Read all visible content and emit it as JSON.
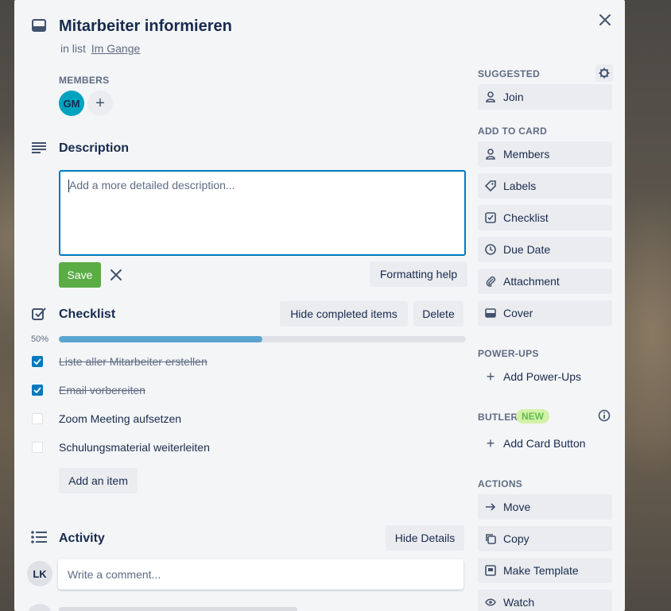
{
  "card": {
    "title": "Mitarbeiter informieren",
    "in_list_prefix": "in list",
    "list_name": "Im Gange"
  },
  "members": {
    "heading": "MEMBERS",
    "avatar_initials": "GM",
    "add_label": "+"
  },
  "description": {
    "title": "Description",
    "placeholder": "Add a more detailed description...",
    "save_label": "Save",
    "formatting_help": "Formatting help"
  },
  "checklist": {
    "title": "Checklist",
    "hide_completed": "Hide completed items",
    "delete_label": "Delete",
    "progress_label": "50%",
    "progress": 0.5,
    "items": [
      {
        "text": "Liste aller Mitarbeiter erstellen",
        "checked": true
      },
      {
        "text": "Email vorbereiten",
        "checked": true
      },
      {
        "text": "Zoom Meeting aufsetzen",
        "checked": false
      },
      {
        "text": "Schulungsmaterial weiterleiten",
        "checked": false
      }
    ],
    "add_item": "Add an item"
  },
  "activity": {
    "title": "Activity",
    "hide_details": "Hide Details",
    "user_initials": "LK",
    "comment_placeholder": "Write a comment..."
  },
  "sidebar": {
    "suggested": "SUGGESTED",
    "join": "Join",
    "add_to_card": "ADD TO CARD",
    "add_items": [
      "Members",
      "Labels",
      "Checklist",
      "Due Date",
      "Attachment",
      "Cover"
    ],
    "power_ups": "POWER-UPS",
    "add_power_ups": "Add Power-Ups",
    "butler": "BUTLER",
    "new_badge": "NEW",
    "add_card_button": "Add Card Button",
    "actions": "ACTIONS",
    "action_items": [
      "Move",
      "Copy",
      "Make Template",
      "Watch"
    ]
  },
  "colors": {
    "accent_blue": "#0079bf",
    "save_green": "#5aac44",
    "avatar_teal": "#00a3bf",
    "new_green": "#61bd4f"
  }
}
